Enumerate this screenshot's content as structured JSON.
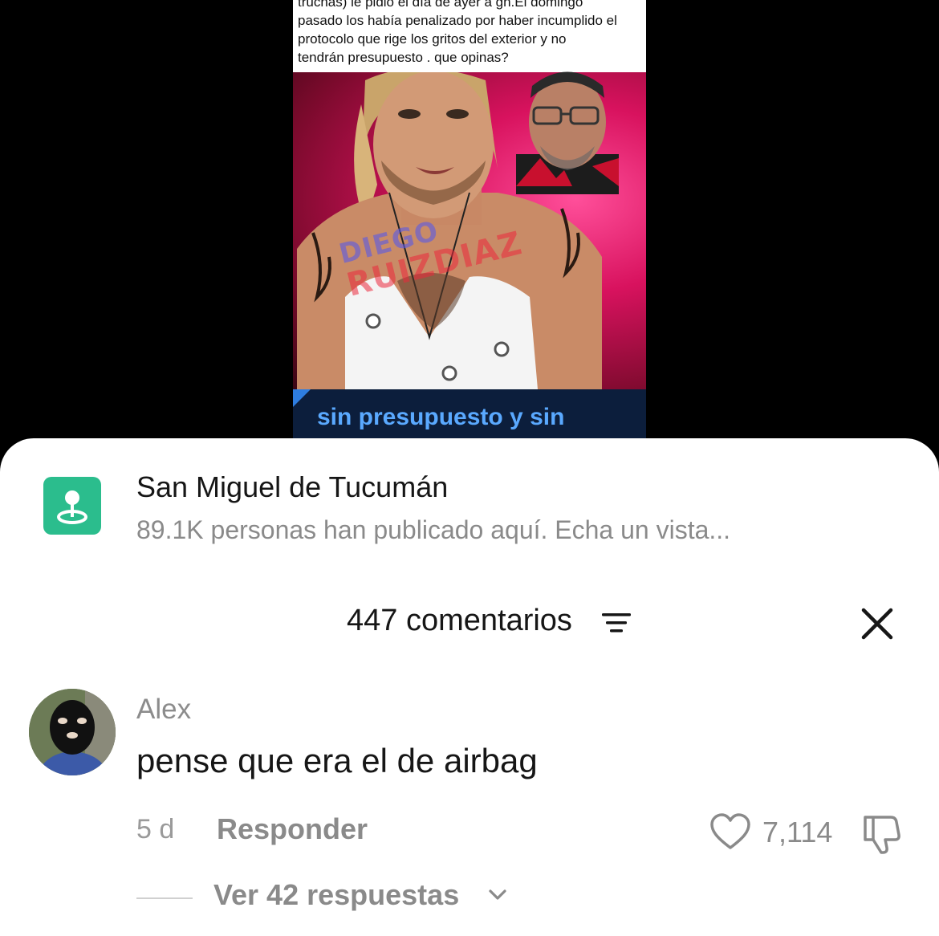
{
  "video": {
    "caption_lines": [
      "truchas) le pidió el día de ayer a gh.El domingo",
      "pasado los había penalizado por haber incumplido el",
      "protocolo que rige los gritos del exterior y no",
      "tendrán  presupuesto . que opinas?"
    ],
    "watermark_line1": "DIEGO",
    "watermark_line2": "RUIZDIAZ",
    "subtitle": "sin presupuesto y sin"
  },
  "location": {
    "icon": "location-pin-icon",
    "title": "San Miguel de Tucumán",
    "subtitle": "89.1K personas han publicado aquí. Echa un vista..."
  },
  "comments": {
    "title": "447 comentarios",
    "sort_icon": "sort-lines-icon",
    "close_icon": "close-icon"
  },
  "comment": {
    "author": "Alex",
    "text": "pense que era el de airbag",
    "time": "5 d",
    "reply_label": "Responder",
    "like_count": "7,114",
    "replies_label": "Ver 42 respuestas"
  },
  "colors": {
    "location_icon_bg": "#2bbd8d",
    "muted_text": "#8a8a8a",
    "subtitle_text": "#5aa9ff"
  }
}
